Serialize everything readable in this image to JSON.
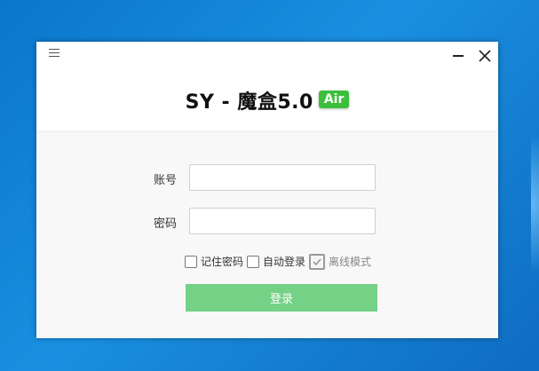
{
  "app": {
    "title": "SY - 魔盒5.0",
    "badge": "Air"
  },
  "window_controls": {
    "menu_icon": "hamburger-icon",
    "minimize_icon": "minimize-icon",
    "close_icon": "close-icon"
  },
  "form": {
    "account_label": "账号",
    "account_value": "",
    "password_label": "密码",
    "password_value": ""
  },
  "options": {
    "remember_password": {
      "label": "记住密码",
      "checked": false
    },
    "auto_login": {
      "label": "自动登录",
      "checked": false
    },
    "offline_mode": {
      "label": "离线模式",
      "checked": true
    }
  },
  "login_button": "登录",
  "colors": {
    "badge": "#3cbf3c",
    "login_button": "#74d186",
    "desktop": "#0a76cc"
  }
}
